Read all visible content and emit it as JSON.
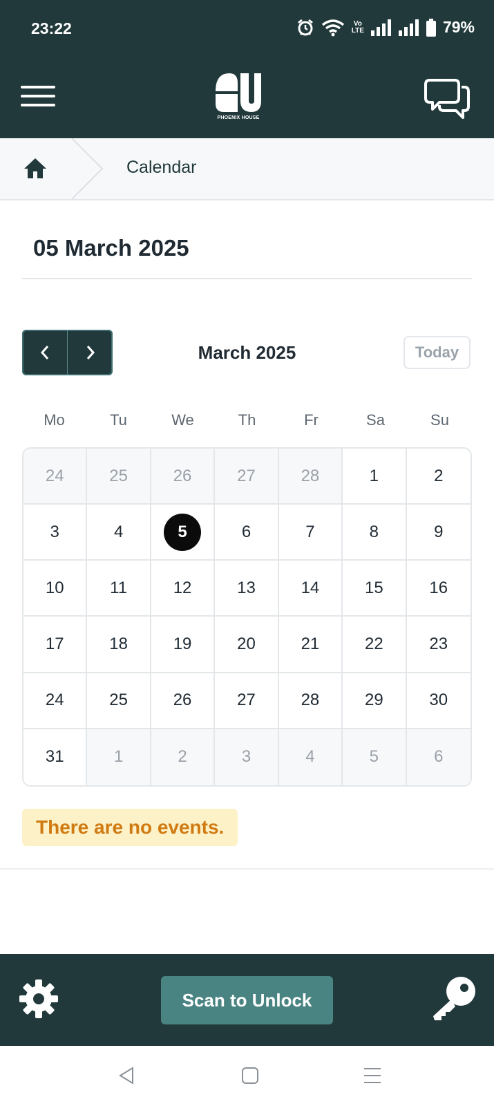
{
  "status_bar": {
    "time": "23:22",
    "volte_top": "Vo",
    "volte_bottom": "LTE",
    "battery": "79%"
  },
  "header": {
    "brand": "PHOENIX HOUSE",
    "icons": [
      "menu-icon",
      "logo",
      "chat-icon"
    ]
  },
  "breadcrumb": {
    "home_icon": "home-icon",
    "current": "Calendar"
  },
  "selected_date_title": "05 March 2025",
  "calendar": {
    "month_label": "March 2025",
    "today_label": "Today",
    "weekdays": [
      "Mo",
      "Tu",
      "We",
      "Th",
      "Fr",
      "Sa",
      "Su"
    ],
    "days": [
      {
        "d": "24",
        "other": true
      },
      {
        "d": "25",
        "other": true
      },
      {
        "d": "26",
        "other": true
      },
      {
        "d": "27",
        "other": true
      },
      {
        "d": "28",
        "other": true
      },
      {
        "d": "1"
      },
      {
        "d": "2"
      },
      {
        "d": "3"
      },
      {
        "d": "4"
      },
      {
        "d": "5",
        "selected": true
      },
      {
        "d": "6"
      },
      {
        "d": "7"
      },
      {
        "d": "8"
      },
      {
        "d": "9"
      },
      {
        "d": "10"
      },
      {
        "d": "11"
      },
      {
        "d": "12"
      },
      {
        "d": "13"
      },
      {
        "d": "14"
      },
      {
        "d": "15"
      },
      {
        "d": "16"
      },
      {
        "d": "17"
      },
      {
        "d": "18"
      },
      {
        "d": "19"
      },
      {
        "d": "20"
      },
      {
        "d": "21"
      },
      {
        "d": "22"
      },
      {
        "d": "23"
      },
      {
        "d": "24"
      },
      {
        "d": "25"
      },
      {
        "d": "26"
      },
      {
        "d": "27"
      },
      {
        "d": "28"
      },
      {
        "d": "29"
      },
      {
        "d": "30"
      },
      {
        "d": "31"
      },
      {
        "d": "1",
        "other": true
      },
      {
        "d": "2",
        "other": true
      },
      {
        "d": "3",
        "other": true
      },
      {
        "d": "4",
        "other": true
      },
      {
        "d": "5",
        "other": true
      },
      {
        "d": "6",
        "other": true
      }
    ]
  },
  "events_message": "There are no events.",
  "bottom_bar": {
    "scan_label": "Scan to Unlock",
    "icons": [
      "gear-icon",
      "key-icon"
    ]
  },
  "colors": {
    "header_bg": "#21393b",
    "scan_button": "#4a8482",
    "notice_bg": "#fdf1c7",
    "notice_text": "#d07a12",
    "selected_day": "#0b0b0b"
  }
}
